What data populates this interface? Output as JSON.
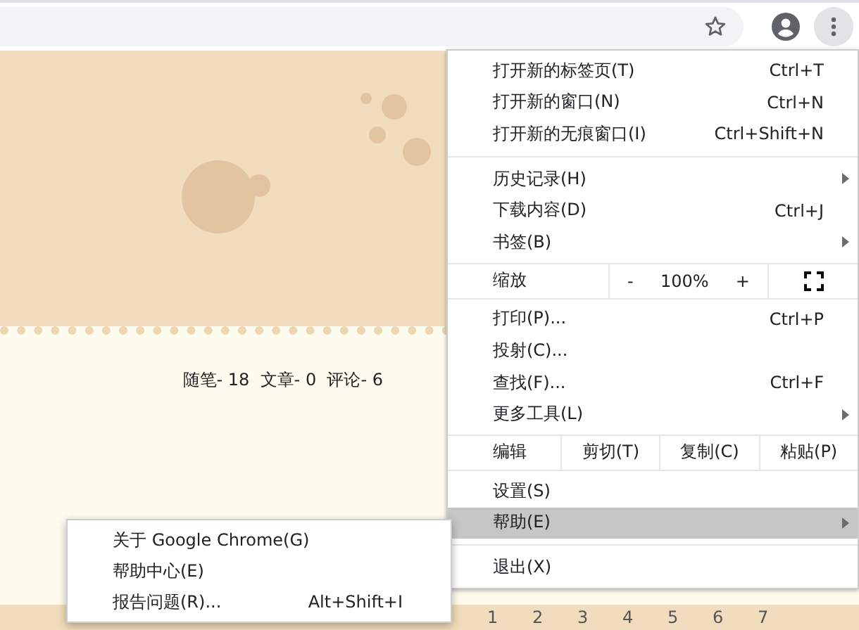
{
  "page": {
    "blog_stats": "随笔- 18  文章- 0  评论- 6",
    "calendar_days": [
      "1",
      "2",
      "3",
      "4",
      "5",
      "6",
      "7"
    ]
  },
  "menu": {
    "items": [
      {
        "kind": "item",
        "label": "打开新的标签页(T)",
        "shortcut": "Ctrl+T",
        "has_submenu": false,
        "highlighted": false
      },
      {
        "kind": "item",
        "label": "打开新的窗口(N)",
        "shortcut": "Ctrl+N",
        "has_submenu": false,
        "highlighted": false
      },
      {
        "kind": "item",
        "label": "打开新的无痕窗口(I)",
        "shortcut": "Ctrl+Shift+N",
        "has_submenu": false,
        "highlighted": false
      },
      {
        "kind": "separator"
      },
      {
        "kind": "item",
        "label": "历史记录(H)",
        "has_submenu": true,
        "highlighted": false
      },
      {
        "kind": "item",
        "label": "下载内容(D)",
        "shortcut": "Ctrl+J",
        "has_submenu": false,
        "highlighted": false
      },
      {
        "kind": "item",
        "label": "书签(B)",
        "has_submenu": true,
        "highlighted": false
      },
      {
        "kind": "zoom",
        "label": "缩放",
        "minus": "-",
        "value": "100%",
        "plus": "+"
      },
      {
        "kind": "item",
        "label": "打印(P)...",
        "shortcut": "Ctrl+P",
        "has_submenu": false,
        "highlighted": false
      },
      {
        "kind": "item",
        "label": "投射(C)...",
        "has_submenu": false,
        "highlighted": false
      },
      {
        "kind": "item",
        "label": "查找(F)...",
        "shortcut": "Ctrl+F",
        "has_submenu": false,
        "highlighted": false
      },
      {
        "kind": "item",
        "label": "更多工具(L)",
        "has_submenu": true,
        "highlighted": false
      },
      {
        "kind": "edit",
        "label": "编辑",
        "buttons": [
          "剪切(T)",
          "复制(C)",
          "粘贴(P)"
        ]
      },
      {
        "kind": "item",
        "label": "设置(S)",
        "has_submenu": false,
        "highlighted": false
      },
      {
        "kind": "item",
        "label": "帮助(E)",
        "has_submenu": true,
        "highlighted": true
      },
      {
        "kind": "separator"
      },
      {
        "kind": "item",
        "label": "退出(X)",
        "has_submenu": false,
        "highlighted": false
      }
    ]
  },
  "submenu": {
    "items": [
      {
        "label": "关于 Google Chrome(G)"
      },
      {
        "label": "帮助中心(E)"
      },
      {
        "label": "报告问题(R)...",
        "shortcut": "Alt+Shift+I"
      }
    ]
  }
}
